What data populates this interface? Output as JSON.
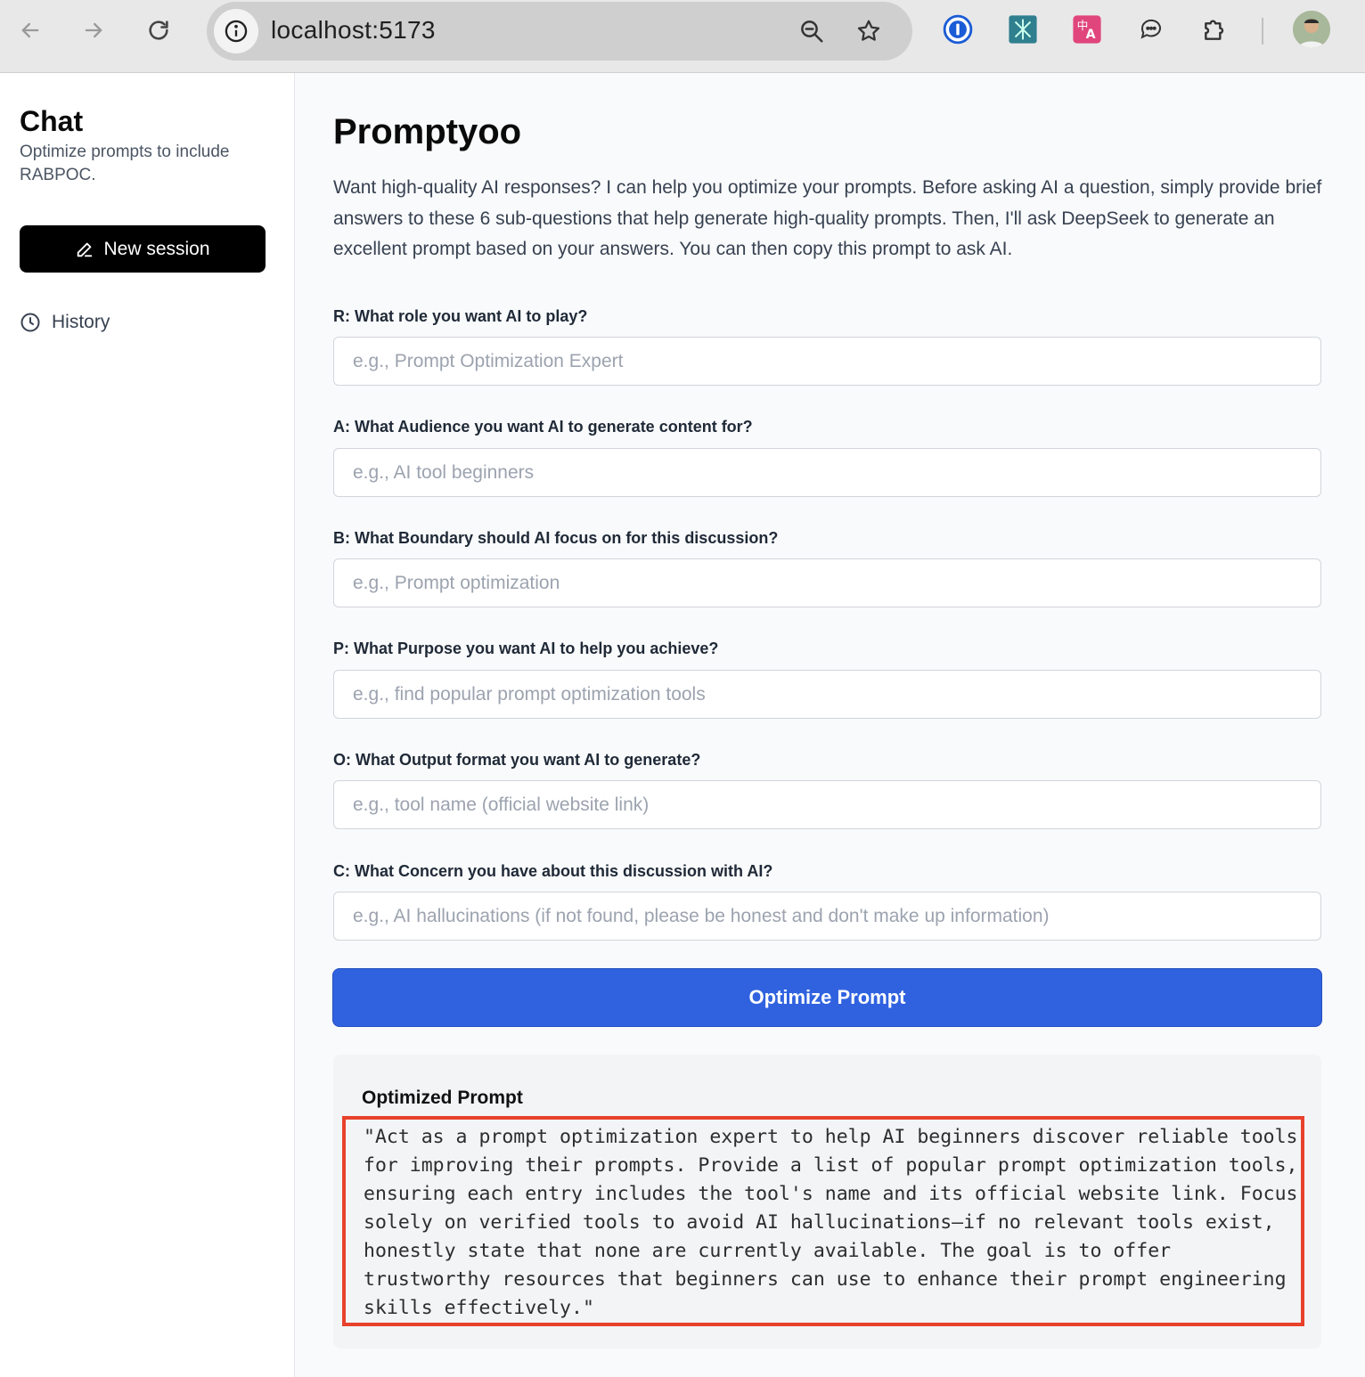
{
  "browser": {
    "url": "localhost:5173"
  },
  "sidebar": {
    "title": "Chat",
    "subtitle": "Optimize prompts to include RABPOC.",
    "new_session_label": "New session",
    "history_label": "History"
  },
  "main": {
    "title": "Promptyoo",
    "intro": "Want high-quality AI responses? I can help you optimize your prompts. Before asking AI a question, simply provide brief answers to these 6 sub-questions that help generate high-quality prompts. Then, I'll ask DeepSeek to generate an excellent prompt based on your answers. You can then copy this prompt to ask AI.",
    "fields": [
      {
        "label": "R: What role you want AI to play?",
        "placeholder": "e.g., Prompt Optimization Expert",
        "value": ""
      },
      {
        "label": "A: What Audience you want AI to generate content for?",
        "placeholder": "e.g., AI tool beginners",
        "value": ""
      },
      {
        "label": "B: What Boundary should AI focus on for this discussion?",
        "placeholder": "e.g., Prompt optimization",
        "value": ""
      },
      {
        "label": "P: What Purpose you want AI to help you achieve?",
        "placeholder": "e.g., find popular prompt optimization tools",
        "value": ""
      },
      {
        "label": "O: What Output format you want AI to generate?",
        "placeholder": "e.g., tool name (official website link)",
        "value": ""
      },
      {
        "label": "C: What Concern you have about this discussion with AI?",
        "placeholder": "e.g., AI hallucinations (if not found, please be honest and don't make up information)",
        "value": ""
      }
    ],
    "optimize_button_label": "Optimize Prompt",
    "result": {
      "title": "Optimized Prompt",
      "text": "\"Act as a prompt optimization expert to help AI beginners discover reliable tools for improving their prompts. Provide a list of popular prompt optimization tools, ensuring each entry includes the tool's name and its official website link. Focus solely on verified tools to avoid AI hallucinations—if no relevant tools exist, honestly state that none are currently available. The goal is to offer trustworthy resources that beginners can use to enhance their prompt engineering skills effectively.\""
    }
  },
  "colors": {
    "primary_button": "#3062e0",
    "new_session_bg": "#000000",
    "highlight_border": "#e8412c"
  }
}
